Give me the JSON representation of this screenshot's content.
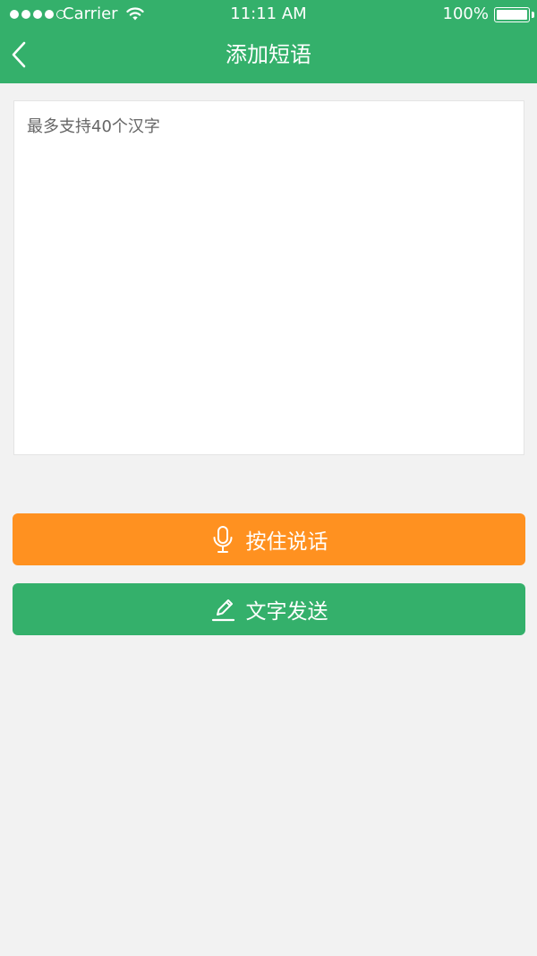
{
  "status_bar": {
    "carrier": "Carrier",
    "time": "11:11 AM",
    "battery": "100%"
  },
  "nav": {
    "title": "添加短语",
    "back_icon": "chevron-left-icon"
  },
  "input": {
    "value": "",
    "placeholder": "最多支持40个汉字"
  },
  "buttons": {
    "voice_label": "按住说话",
    "voice_icon": "microphone-icon",
    "voice_color": "#ff9120",
    "text_label": "文字发送",
    "text_icon": "pencil-icon",
    "text_color": "#34b06b"
  },
  "colors": {
    "brand_green": "#34b06b",
    "background": "#f2f2f2"
  }
}
